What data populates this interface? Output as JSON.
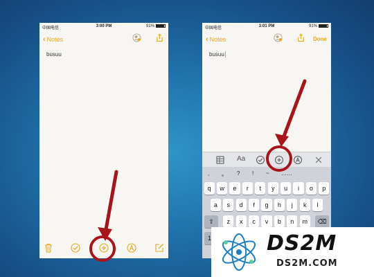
{
  "left_phone": {
    "status": {
      "carrier": "中国电信",
      "time": "3:00 PM",
      "battery": "91%"
    },
    "nav": {
      "back_label": "Notes"
    },
    "note_text": "busuu"
  },
  "right_phone": {
    "status": {
      "carrier": "中国电信",
      "time": "3:01 PM",
      "battery": "91%"
    },
    "nav": {
      "back_label": "Notes",
      "done_label": "Done"
    },
    "note_text": "busuu",
    "format_bar": {
      "aa_label": "Aa"
    },
    "punctuation": [
      ",",
      "。",
      "?",
      "!",
      "~",
      "……"
    ],
    "keyboard_rows": [
      [
        "q",
        "w",
        "e",
        "r",
        "t",
        "y",
        "u",
        "i",
        "o",
        "p"
      ],
      [
        "a",
        "s",
        "d",
        "f",
        "g",
        "h",
        "j",
        "k",
        "l"
      ],
      [
        "z",
        "x",
        "c",
        "v",
        "b",
        "n",
        "m"
      ]
    ],
    "numbers_key": "12"
  },
  "watermark": {
    "logo_big": "DS2M",
    "logo_small": "DS2M.COM"
  },
  "colors": {
    "accent": "#e6a81d",
    "annotation": "#a8141c"
  }
}
